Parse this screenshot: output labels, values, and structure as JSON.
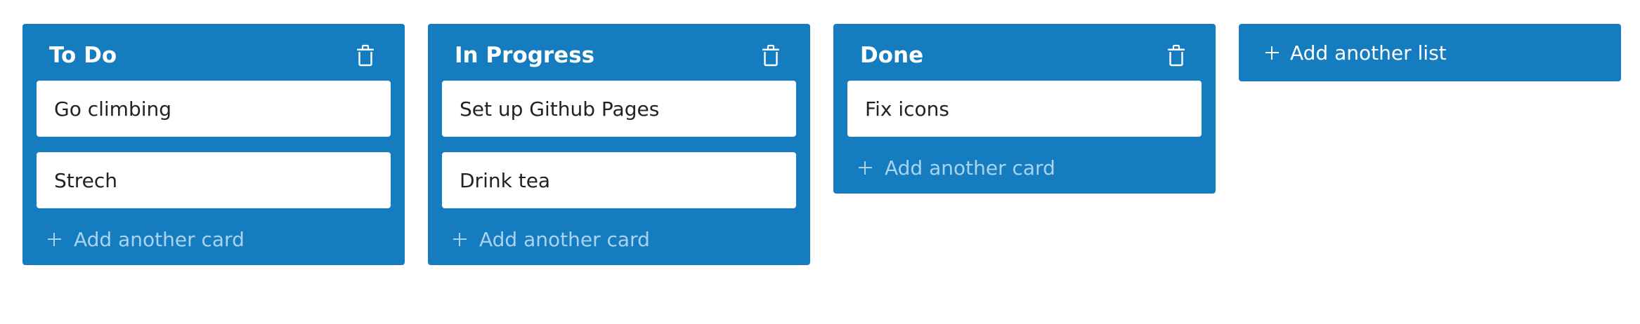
{
  "colors": {
    "list_background": "#147cbf",
    "card_background": "#ffffff",
    "card_text": "#222222",
    "add_card_text": "#a9d3ef",
    "page_background": "#ffffff"
  },
  "lists": [
    {
      "title": "To Do",
      "delete_icon": "trash-icon",
      "cards": [
        "Go climbing",
        "Strech"
      ],
      "add_card_label": "Add another card"
    },
    {
      "title": "In Progress",
      "delete_icon": "trash-icon",
      "cards": [
        "Set up Github Pages",
        "Drink tea"
      ],
      "add_card_label": "Add another card"
    },
    {
      "title": "Done",
      "delete_icon": "trash-icon",
      "cards": [
        "Fix icons"
      ],
      "add_card_label": "Add another card"
    }
  ],
  "add_list": {
    "label": "Add another list",
    "icon": "plus-icon"
  }
}
